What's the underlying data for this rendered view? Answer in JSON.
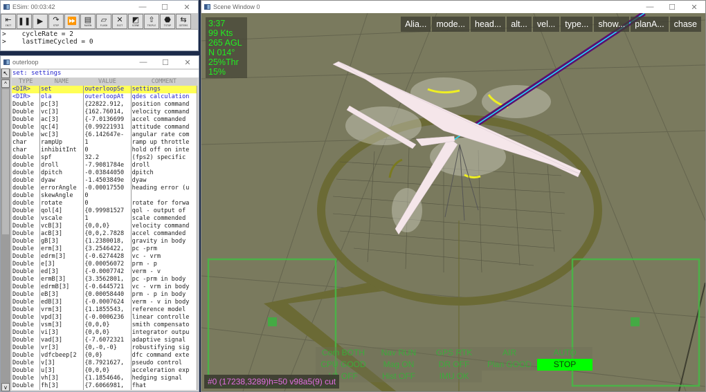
{
  "esim": {
    "title": "ESim: 00:03:42",
    "window_controls": [
      "—",
      "☐",
      "✕"
    ],
    "toolbar": [
      {
        "name": "init",
        "glyph": "⇤",
        "caption": "INIT"
      },
      {
        "name": "pause",
        "glyph": "❚❚",
        "caption": ""
      },
      {
        "name": "run",
        "glyph": "▶",
        "caption": ""
      },
      {
        "name": "step",
        "glyph": "↷",
        "caption": "STEP"
      },
      {
        "name": "fast-forward",
        "glyph": "⏩",
        "caption": ""
      },
      {
        "name": "raven",
        "glyph": "▤",
        "caption": "RAVEN"
      },
      {
        "name": "flush",
        "glyph": "▱",
        "caption": "FLUSH"
      },
      {
        "name": "exit",
        "glyph": "✕",
        "caption": "EXIT"
      },
      {
        "name": "scene",
        "glyph": "◩",
        "caption": "SCENE"
      },
      {
        "name": "triple",
        "glyph": "⇧",
        "caption": "TRIPLE"
      },
      {
        "name": "tstop",
        "glyph": "⬣",
        "caption": "TSTOP"
      },
      {
        "name": "geters",
        "glyph": "⇆",
        "caption": "GETERS"
      }
    ],
    "console": [
      ">    cycleRate = 2",
      ">    lastTimeCycled = 0"
    ]
  },
  "outerloop": {
    "title": "outerloop",
    "window_controls": [
      "—",
      "☐",
      "✕"
    ],
    "path": "set: settings",
    "columns": [
      "TYPE",
      "NAME",
      "VALUE",
      "COMMENT"
    ],
    "rows": [
      {
        "type": "<DIR>",
        "name": "set",
        "value": "outerloopSe",
        "comment": "settings",
        "kind": "dir",
        "selected": true
      },
      {
        "type": "<DIR>",
        "name": "ola",
        "value": "outerloopAt",
        "comment": "qdes calculation",
        "kind": "dir",
        "selected": false
      },
      {
        "type": "Double",
        "name": "pc[3]",
        "value": "{22822.912,",
        "comment": "position command"
      },
      {
        "type": "Double",
        "name": "vc[3]",
        "value": "{162.76014,",
        "comment": "velocity command"
      },
      {
        "type": "Double",
        "name": "ac[3]",
        "value": "{-7.0136699",
        "comment": "accel commanded"
      },
      {
        "type": "Double",
        "name": "qc[4]",
        "value": "{0.99221931",
        "comment": "attitude command"
      },
      {
        "type": "Double",
        "name": "wc[3]",
        "value": "{6.142647e-",
        "comment": "angular rate com"
      },
      {
        "type": "char",
        "name": "rampUp",
        "value": "1",
        "comment": "ramp up throttle"
      },
      {
        "type": "char",
        "name": "inhibitInt",
        "value": "0",
        "comment": "hold off on inte"
      },
      {
        "type": "double",
        "name": "spf",
        "value": "32.2",
        "comment": "(fps2) specific"
      },
      {
        "type": "double",
        "name": "droll",
        "value": "-7.9081784e",
        "comment": "droll"
      },
      {
        "type": "double",
        "name": "dpitch",
        "value": "-0.03844050",
        "comment": "dpitch"
      },
      {
        "type": "double",
        "name": "dyaw",
        "value": "-1.4503849e",
        "comment": "dyaw"
      },
      {
        "type": "double",
        "name": "errorAngle",
        "value": "-0.00017550",
        "comment": "heading error (u"
      },
      {
        "type": "double",
        "name": "skewAngle",
        "value": "0",
        "comment": ""
      },
      {
        "type": "double",
        "name": "rotate",
        "value": "0",
        "comment": "rotate for forwa"
      },
      {
        "type": "Double",
        "name": "qol[4]",
        "value": "{0.99981527",
        "comment": "qol - output of"
      },
      {
        "type": "double",
        "name": "vscale",
        "value": "1",
        "comment": "scale commended"
      },
      {
        "type": "Double",
        "name": "vcB[3]",
        "value": "{0,0,0}",
        "comment": "velocity command"
      },
      {
        "type": "Double",
        "name": "acB[3]",
        "value": "{0,0,2.7828",
        "comment": "accel commanded"
      },
      {
        "type": "Double",
        "name": "gB[3]",
        "value": "{1.2380018,",
        "comment": "gravity in body"
      },
      {
        "type": "Double",
        "name": "erm[3]",
        "value": "{3.2546422,",
        "comment": "pc -prm"
      },
      {
        "type": "Double",
        "name": "edrm[3]",
        "value": "{-0.6274428",
        "comment": "vc - vrm"
      },
      {
        "type": "Double",
        "name": "e[3]",
        "value": "{0.00056072",
        "comment": "prm - p"
      },
      {
        "type": "Double",
        "name": "ed[3]",
        "value": "{-0.0007742",
        "comment": "verm - v"
      },
      {
        "type": "Double",
        "name": "ermB[3]",
        "value": "{3.3562801,",
        "comment": "pc -prm in body"
      },
      {
        "type": "Double",
        "name": "edrmB[3]",
        "value": "{-0.6445721",
        "comment": "vc - vrm in body"
      },
      {
        "type": "Double",
        "name": "eB[3]",
        "value": "{0.00058440",
        "comment": "prm - p in body"
      },
      {
        "type": "Double",
        "name": "edB[3]",
        "value": "{-0.0007624",
        "comment": "verm - v in body"
      },
      {
        "type": "Double",
        "name": "vrm[3]",
        "value": "{1.1855543,",
        "comment": "reference model"
      },
      {
        "type": "Double",
        "name": "vpd[3]",
        "value": "{-0.0006236",
        "comment": "linear controlle"
      },
      {
        "type": "Double",
        "name": "vsm[3]",
        "value": "{0,0,0}",
        "comment": "smith compensato"
      },
      {
        "type": "Double",
        "name": "vi[3]",
        "value": "{0,0,0}",
        "comment": "integrator outpu"
      },
      {
        "type": "Double",
        "name": "vad[3]",
        "value": "{-7.6072321",
        "comment": "adaptive signal"
      },
      {
        "type": "Double",
        "name": "vr[3]",
        "value": "{0,-0,-0}",
        "comment": "robustifying sig"
      },
      {
        "type": "Double",
        "name": "vdfcbeep[2",
        "value": "{0,0}",
        "comment": "dfc command exte"
      },
      {
        "type": "Double",
        "name": "v[3]",
        "value": "{8.7921627,",
        "comment": "pseudo control"
      },
      {
        "type": "Double",
        "name": "u[3]",
        "value": "{0,0,0}",
        "comment": "acceleration exp"
      },
      {
        "type": "Double",
        "name": "vh[3]",
        "value": "{1.1854646,",
        "comment": "hedging signal"
      },
      {
        "type": "Double",
        "name": "fh[3]",
        "value": "{7.6066981,",
        "comment": "fhat"
      }
    ]
  },
  "scene": {
    "title": "Scene Window 0",
    "window_controls": [
      "—",
      "☐",
      "✕"
    ],
    "hud": [
      "3:37",
      "99 Kts",
      "265 AGL",
      "N 014°",
      "25%Thr",
      "15%"
    ],
    "menu": [
      "Alia...",
      "mode...",
      "head...",
      "alt...",
      "vel...",
      "type...",
      "show...",
      "planA...",
      "chase"
    ],
    "status": [
      {
        "label": "Com BOTH"
      },
      {
        "label": "Nav RUN"
      },
      {
        "label": "GPS RTK"
      },
      {
        "label": "AIR"
      },
      {
        "label": "AUTO"
      },
      {
        "label": "CPU GOOD"
      },
      {
        "label": "Mag ON"
      },
      {
        "label": "DR OFF"
      },
      {
        "label": "Plan GOOD"
      },
      {
        "label": "STOP",
        "active": true
      },
      {
        "label": "VA OFF"
      },
      {
        "label": "Hist OFF"
      },
      {
        "label": "IMU OK"
      },
      {
        "label": ""
      },
      {
        "label": ""
      }
    ],
    "coord_readout": "#0  (17238,3289)h=50 v98a5(9) cut",
    "colors": {
      "hud_text": "#22ee22",
      "status_active_bg": "#00ff00",
      "ground": "#7a7a5e",
      "pad_ring": "#6b6a35",
      "flight_path": "#5a1070",
      "flight_path_core": "#22e0ff",
      "readout_text": "#e070e0"
    }
  }
}
